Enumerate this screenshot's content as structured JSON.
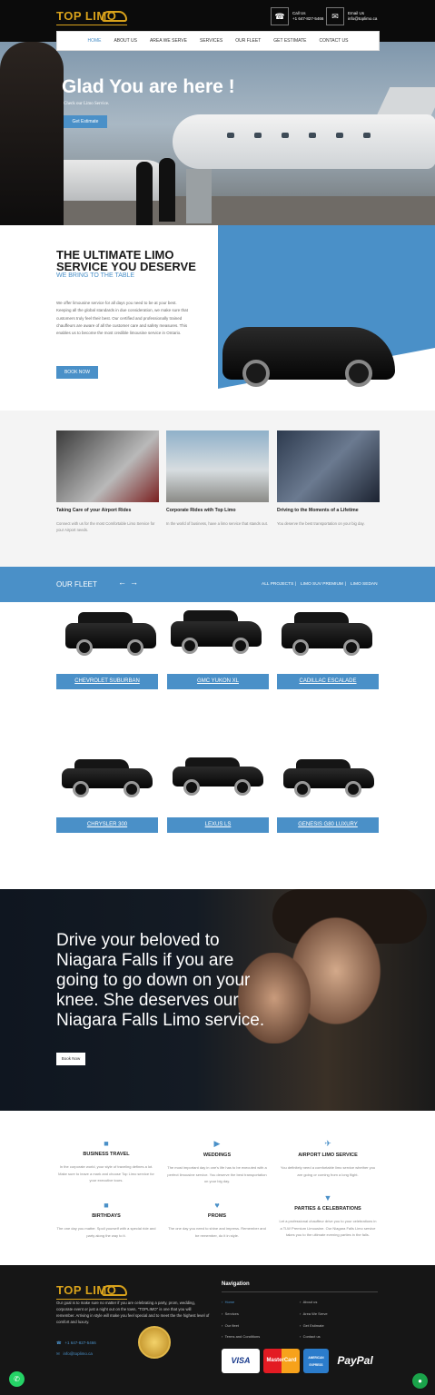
{
  "header": {
    "logo_text": "TOP LIMO",
    "call_label": "Call Us",
    "call_value": "+1 647-827-5466",
    "email_label": "Email Us",
    "email_value": "info@toplimo.ca"
  },
  "nav": {
    "items": [
      "HOME",
      "ABOUT US",
      "AREA WE SERVE",
      "SERVICES",
      "OUR FLEET",
      "GET ESTIMATE",
      "CONTACT US"
    ]
  },
  "hero": {
    "title": "Glad You are here !",
    "subtitle": "Check our Limo Service.",
    "button": "Get Estimate"
  },
  "intro": {
    "heading": "THE ULTIMATE LIMO SERVICE YOU DESERVE",
    "subheading": "WE BRING TO THE TABLE",
    "paragraph": "We offer limousine service for all days you need to be at your best. Keeping all the global standards in due consideration, we make sure that customers truly feel their best. Our certified and professionally trained chauffeurs are aware of all the customer care and safety measures. This enables us to become the most credible limousine service in Ontario.",
    "button": "BOOK NOW"
  },
  "cards": [
    {
      "title": "Taking Care of your Airport Rides",
      "desc": "Connect with us for the most Comfortable Limo Service for your Airport needs."
    },
    {
      "title": "Corporate Rides with Top Limo",
      "desc": "In the world of business, have a limo service that stands out."
    },
    {
      "title": "Driving to the Moments of a Lifetime",
      "desc": "You deserve the best transportation on your big day."
    }
  ],
  "fleet": {
    "title": "OUR FLEET",
    "prev_arrow": "←",
    "next_arrow": "→",
    "filters": [
      "ALL PROJECTS",
      "LIMO SUV PREMIUM",
      "LIMO SEDAN"
    ],
    "vehicles": [
      "CHEVROLET SUBURBAN",
      "GMC YUKON XL",
      "CADILLAC ESCALADE",
      "CHRYSLER 300",
      "LEXUS LS",
      "GENESIS G80 LUXURY"
    ]
  },
  "promo": {
    "text": "Drive your beloved to Niagara Falls if you are going to go down on your knee. She deserves our Niagara Falls Limo service.",
    "button": "Book Now"
  },
  "services": [
    {
      "icon": "briefcase",
      "title": "BUSINESS TRAVEL",
      "desc": "In the corporate world, your style of traveling defines a lot. Make sure to leave a mark and choose Top Limo service for your executive tours."
    },
    {
      "icon": "camera",
      "title": "WEDDINGS",
      "desc": "The most important day in one's life has to be executed with a perfect limousine service. You deserve the best transportation on your big day."
    },
    {
      "icon": "plane",
      "title": "AIRPORT LIMO SERVICE",
      "desc": "You definitely need a comfortable limo service whether you are going or coming from a long flight."
    },
    {
      "icon": "gift",
      "title": "BIRTHDAYS",
      "desc": "The one day you matter. Spoil yourself with a special ride and party along the way to it."
    },
    {
      "icon": "heart",
      "title": "PROMS",
      "desc": "The one day you need to shine and impress. Remember and be remember, do it in style."
    },
    {
      "icon": "cocktail",
      "title": "PARTIES & CELEBRATIONS",
      "desc": "Let a professional chauffeur drive you to your celebrations in a TLW Premium Limousine. Our Niagara Falls Limo service takes you to the ultimate evening parties in the falls."
    }
  ],
  "footer": {
    "about": "Our goal is to make sure no matter if you are celebrating a party, prom, wedding, corporate event or just a night out on the town, \"TOPLIMO\" is one that you will remember. Arriving in style will make you feel special and to meet the the highest level of comfort and luxury.",
    "phone": "+1 647-827-5466",
    "email": "info@toplimo.ca",
    "nav_heading": "Navigation",
    "links_left": [
      "Home",
      "Services",
      "Our fleet",
      "Terms and Conditions"
    ],
    "links_right": [
      "About us",
      "Area We Serve",
      "Get Estimate",
      "Contact us"
    ],
    "payments": [
      "VISA",
      "MasterCard",
      "AMERICAN EXPRESS",
      "PayPal"
    ]
  },
  "colors": {
    "accent": "#4a90c8",
    "gold": "#d9a21b",
    "dark": "#0b0b0b"
  }
}
